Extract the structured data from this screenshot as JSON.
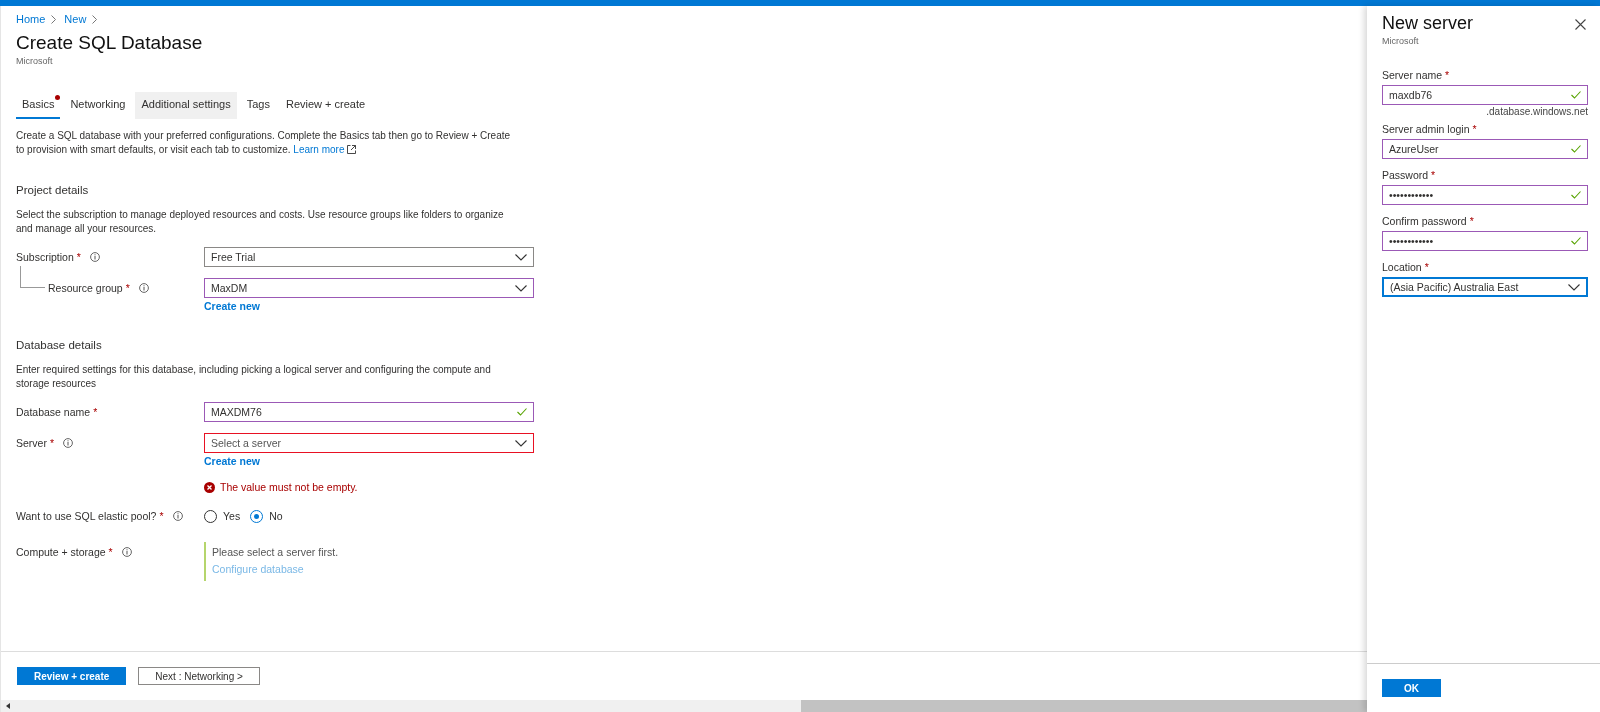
{
  "breadcrumb": [
    {
      "label": "Home"
    },
    {
      "label": "New"
    }
  ],
  "page": {
    "title": "Create SQL Database",
    "subtitle": "Microsoft"
  },
  "tabs": [
    {
      "label": "Basics",
      "selected": true,
      "error": true,
      "hovered": false
    },
    {
      "label": "Networking",
      "selected": false,
      "error": false,
      "hovered": false
    },
    {
      "label": "Additional settings",
      "selected": false,
      "error": false,
      "hovered": true
    },
    {
      "label": "Tags",
      "selected": false,
      "error": false,
      "hovered": false
    },
    {
      "label": "Review + create",
      "selected": false,
      "error": false,
      "hovered": false
    }
  ],
  "intro": {
    "text": "Create a SQL database with your preferred configurations. Complete the Basics tab then go to Review + Create to provision with smart defaults, or visit each tab to customize.",
    "link": "Learn more"
  },
  "sections": [
    {
      "title": "Project details",
      "description": "Select the subscription to manage deployed resources and costs. Use resource groups like folders to organize and manage all your resources.",
      "fields": [
        {
          "kind": "dropdown",
          "label": "Subscription",
          "required_mark": "*",
          "info": true,
          "value": "Free Trial",
          "children": [
            {
              "kind": "dropdown",
              "label": "Resource group",
              "required_mark": "*",
              "info": true,
              "value": "MaxDM",
              "valid": true,
              "link": "Create new"
            }
          ]
        }
      ]
    },
    {
      "title": "Database details",
      "description": "Enter required settings for this database, including picking a logical server and configuring the compute and storage resources",
      "fields": [
        {
          "kind": "text",
          "label": "Database name",
          "required_mark": "*",
          "value": "MAXDM76",
          "valid": true
        },
        {
          "kind": "dropdown",
          "label": "Server",
          "required_mark": "*",
          "info": true,
          "placeholder": "Select a server",
          "link": "Create new",
          "error": "The value must not be empty."
        },
        {
          "kind": "radio",
          "label": "Want to use SQL elastic pool?",
          "required_mark": "*",
          "info": true,
          "options": [
            {
              "label": "Yes",
              "selected": false
            },
            {
              "label": "No",
              "selected": true
            }
          ]
        },
        {
          "kind": "notice",
          "label": "Compute + storage",
          "required_mark": "*",
          "info": true,
          "message": "Please select a server first.",
          "link": "Configure database",
          "disabled": true
        }
      ]
    }
  ],
  "footer_buttons": [
    {
      "label": "Review + create",
      "kind": "primary"
    },
    {
      "label": "Next : Networking >",
      "kind": "secondary"
    }
  ],
  "panel": {
    "title": "New server",
    "subtitle": "Microsoft",
    "fields": [
      {
        "kind": "text",
        "label": "Server name",
        "required_mark": "*",
        "value": "maxdb76",
        "valid": true,
        "suffix": ".database.windows.net"
      },
      {
        "kind": "text",
        "label": "Server admin login",
        "required_mark": "*",
        "value": "AzureUser",
        "valid": true
      },
      {
        "kind": "text",
        "label": "Password",
        "required_mark": "*",
        "value": "••••••••••••",
        "valid": true
      },
      {
        "kind": "text",
        "label": "Confirm password",
        "required_mark": "*",
        "value": "••••••••••••",
        "valid": true
      },
      {
        "kind": "dropdown",
        "label": "Location",
        "required_mark": "*",
        "value": "(Asia Pacific) Australia East",
        "focused": true
      }
    ],
    "ok_button": "OK"
  }
}
